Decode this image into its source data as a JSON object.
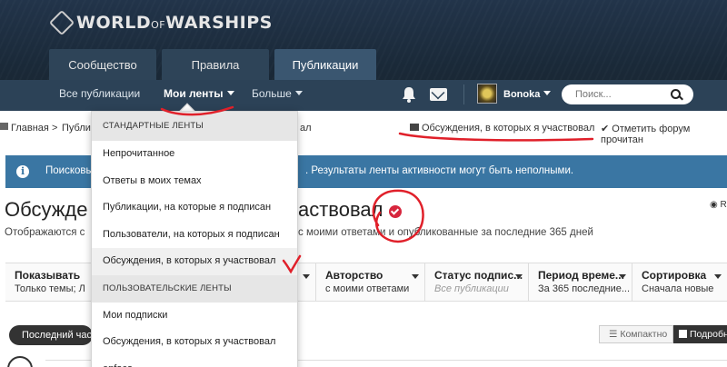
{
  "header": {
    "logo_text": "WORLD",
    "logo_of": "OF",
    "logo_text2": "WARSHIPS",
    "tabs": [
      {
        "label": "Сообщество"
      },
      {
        "label": "Правила"
      },
      {
        "label": "Публикации"
      }
    ],
    "subnav": {
      "all": "Все публикации",
      "my_feeds": "Мои ленты",
      "more": "Больше"
    },
    "username": "Bonoka",
    "search_placeholder": "Поиск..."
  },
  "breadcrumb": {
    "home": "Главная",
    "sep": ">",
    "second": "Публи",
    "third_tail": "ал"
  },
  "crumb_actions": {
    "discussions": "Обсуждения, в которых я участвовал",
    "mark_read": "Отметить форум прочитан"
  },
  "info": {
    "text_a": "Поисковы",
    "text_b": ". Результаты ленты активности могут быть неполными."
  },
  "page": {
    "title_a": "Обсужде",
    "title_b": "аствовал",
    "rss": "R",
    "subtitle_a": "Отображаются с",
    "subtitle_b": "с моими ответами и опубликованные за последние 365 дней"
  },
  "filters": [
    {
      "label": "Показывать",
      "value": "Только темы; Л"
    },
    {
      "label": "",
      "value": ""
    },
    {
      "label": "Авторство",
      "value": "с моими ответами"
    },
    {
      "label": "Статус подпис...",
      "value": "Все публикации"
    },
    {
      "label": "Период време...",
      "value": "За 365 последние..."
    },
    {
      "label": "Сортировка",
      "value": "Сначала новые"
    }
  ],
  "bottom": {
    "pill": "Последний час",
    "compact": "Компактно",
    "detailed": "Подробно"
  },
  "dropdown": {
    "section_standard": "СТАНДАРТНЫЕ ЛЕНТЫ",
    "standard_items": [
      "Непрочитанное",
      "Ответы в моих темах",
      "Публикации, на которые я подписан",
      "Пользователи, на которых я подписан",
      "Обсуждения, в которых я участвовал"
    ],
    "section_custom": "ПОЛЬЗОВАТЕЛЬСКИЕ ЛЕНТЫ",
    "custom_items": [
      "Мои подписки",
      "Обсуждения, в которых я участвовал",
      "enfoco"
    ]
  },
  "colors": {
    "header_bg": "#1b2a38",
    "subnav_bg": "#2c4257",
    "info_bg": "#3a76a3",
    "annotation_red": "#e0202a"
  }
}
